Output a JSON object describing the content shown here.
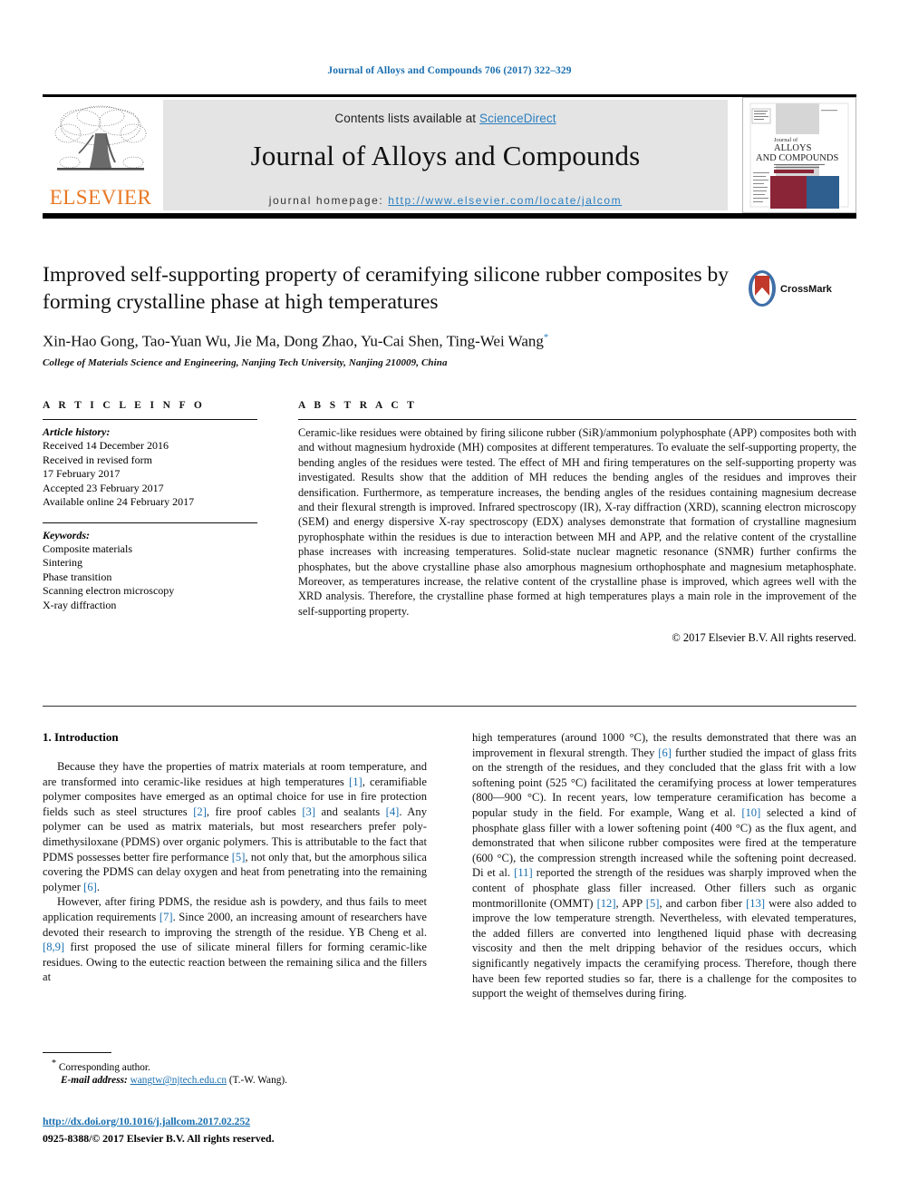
{
  "running_head": "Journal of Alloys and Compounds 706 (2017) 322–329",
  "masthead": {
    "contents_prefix": "Contents lists available at ",
    "sciencedirect": "ScienceDirect",
    "journal_name": "Journal of Alloys and Compounds",
    "homepage_prefix": "journal homepage: ",
    "homepage_url": "http://www.elsevier.com/locate/jalcom",
    "publisher": "ELSEVIER",
    "cover": {
      "line1": "Journal of",
      "line2": "ALLOYS",
      "line3": "AND COMPOUNDS"
    },
    "link_color": "#2b7fc0",
    "panel_bg": "#e4e4e4",
    "elsevier_orange": "#e87722"
  },
  "title_block": {
    "title": "Improved self-supporting property of ceramifying silicone rubber composites by forming crystalline phase at high temperatures",
    "authors": "Xin-Hao Gong, Tao-Yuan Wu, Jie Ma, Dong Zhao, Yu-Cai Shen, Ting-Wei Wang",
    "corresponding_marker": "*",
    "affiliation": "College of Materials Science and Engineering, Nanjing Tech University, Nanjing 210009, China",
    "crossmark_label": "CrossMark"
  },
  "article_info": {
    "heading": "A R T I C L E   I N F O",
    "history_label": "Article history:",
    "history": [
      "Received 14 December 2016",
      "Received in revised form",
      "17 February 2017",
      "Accepted 23 February 2017",
      "Available online 24 February 2017"
    ],
    "keywords_label": "Keywords:",
    "keywords": [
      "Composite materials",
      "Sintering",
      "Phase transition",
      "Scanning electron microscopy",
      "X-ray diffraction"
    ]
  },
  "abstract": {
    "heading": "A B S T R A C T",
    "text": "Ceramic-like residues were obtained by firing silicone rubber (SiR)/ammonium polyphosphate (APP) composites both with and without magnesium hydroxide (MH) composites at different temperatures. To evaluate the self-supporting property, the bending angles of the residues were tested. The effect of MH and firing temperatures on the self-supporting property was investigated. Results show that the addition of MH reduces the bending angles of the residues and improves their densification. Furthermore, as temperature increases, the bending angles of the residues containing magnesium decrease and their flexural strength is improved. Infrared spectroscopy (IR), X-ray diffraction (XRD), scanning electron microscopy (SEM) and energy dispersive X-ray spectroscopy (EDX) analyses demonstrate that formation of crystalline magnesium pyrophosphate within the residues is due to interaction between MH and APP, and the relative content of the crystalline phase increases with increasing temperatures. Solid-state nuclear magnetic resonance (SNMR) further confirms the phosphates, but the above crystalline phase also amorphous magnesium orthophosphate and magnesium metaphosphate. Moreover, as temperatures increase, the relative content of the crystalline phase is improved, which agrees well with the XRD analysis. Therefore, the crystalline phase formed at high temperatures plays a main role in the improvement of the self-supporting property.",
    "copyright": "© 2017 Elsevier B.V. All rights reserved."
  },
  "introduction": {
    "section_title": "1.  Introduction",
    "left_paragraphs": [
      "Because they have the properties of matrix materials at room temperature, and are transformed into ceramic-like residues at high temperatures [1], ceramifiable polymer composites have emerged as an optimal choice for use in fire protection fields such as steel structures [2], fire proof cables [3] and sealants [4]. Any polymer can be used as matrix materials, but most researchers prefer poly-dimethysiloxane (PDMS) over organic polymers. This is attributable to the fact that PDMS possesses better fire performance [5], not only that, but the amorphous silica covering the PDMS can delay oxygen and heat from penetrating into the remaining polymer [6].",
      "However, after firing PDMS, the residue ash is powdery, and thus fails to meet application requirements [7]. Since 2000, an increasing amount of researchers have devoted their research to improving the strength of the residue. YB Cheng et al. [8,9] first proposed the use of silicate mineral fillers for forming ceramic-like residues. Owing to the eutectic reaction between the remaining silica and the fillers at"
    ],
    "right_paragraphs": [
      "high temperatures (around 1000 °C), the results demonstrated that there was an improvement in flexural strength. They [6] further studied the impact of glass frits on the strength of the residues, and they concluded that the glass frit with a low softening point (525 °C) facilitated the ceramifying process at lower temperatures (800—900 °C). In recent years, low temperature ceramification has become a popular study in the field. For example, Wang et al. [10] selected a kind of phosphate glass filler with a lower softening point (400 °C) as the flux agent, and demonstrated that when silicone rubber composites were fired at the temperature (600 °C), the compression strength increased while the softening point decreased. Di et al. [11] reported the strength of the residues was sharply improved when the content of phosphate glass filler increased. Other fillers such as organic montmorillonite (OMMT) [12], APP [5], and carbon fiber [13] were also added to improve the low temperature strength. Nevertheless, with elevated temperatures, the added fillers are converted into lengthened liquid phase with decreasing viscosity and then the melt dripping behavior of the residues occurs, which significantly negatively impacts the ceramifying process. Therefore, though there have been few reported studies so far, there is a challenge for the composites to support the weight of themselves during firing."
    ]
  },
  "footnote": {
    "corresponding_author": "Corresponding author.",
    "email_label": "E-mail address:",
    "email": "wangtw@njtech.edu.cn",
    "email_suffix": "(T.-W. Wang).",
    "doi_url": "http://dx.doi.org/10.1016/j.jallcom.2017.02.252",
    "issn_line": "0925-8388/© 2017 Elsevier B.V. All rights reserved."
  }
}
